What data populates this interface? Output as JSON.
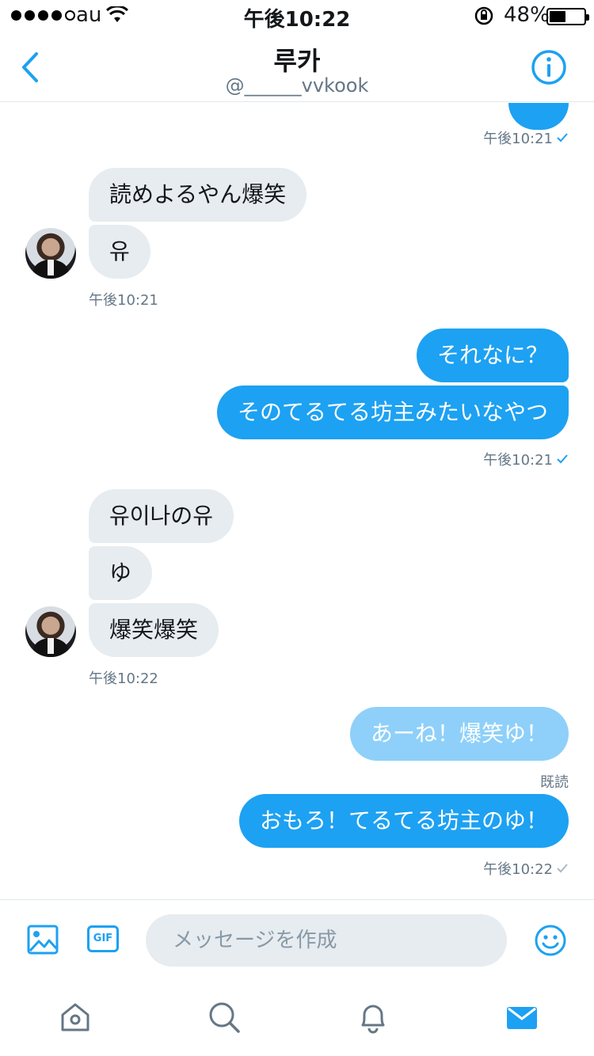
{
  "status_bar": {
    "carrier": "au",
    "time": "午後10:22",
    "battery": "48%",
    "battery_level": 0.48
  },
  "header": {
    "title": "루카",
    "handle": "@______vvkook",
    "back_icon": "chevron-left-icon",
    "info_icon": "info-icon"
  },
  "chat": {
    "top_partial": {
      "time": "午後10:21"
    },
    "group1": {
      "msg1": "読めよるやん爆笑",
      "msg2": "유",
      "time": "午後10:21"
    },
    "group2": {
      "msg1": "それなに？",
      "msg2": "そのてるてる坊主みたいなやつ",
      "time": "午後10:21"
    },
    "group3": {
      "msg1": "유이나の유",
      "msg2": "ゆ",
      "msg3": "爆笑爆笑",
      "time": "午後10:22"
    },
    "group4": {
      "msg1": "あーね！爆笑ゆ！",
      "read": "既読"
    },
    "group5": {
      "msg1": "おもろ！てるてる坊主のゆ！",
      "time": "午後10:22"
    }
  },
  "composer": {
    "placeholder": "メッセージを作成",
    "gif_label": "GIF"
  },
  "tabbar": {
    "items": [
      "home-icon",
      "search-icon",
      "bell-icon",
      "mail-icon"
    ],
    "active": "mail-icon"
  },
  "colors": {
    "accent": "#1da1f2",
    "incoming_bubble": "#e6ecf0",
    "pending_bubble": "#8ed0f9",
    "meta_text": "#657786",
    "icon_gray": "#657786"
  }
}
